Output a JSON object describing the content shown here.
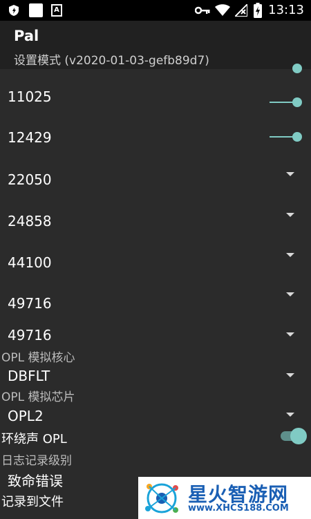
{
  "status_bar": {
    "time": "13:13",
    "left_icons": [
      "shield-icon",
      "square-icon",
      "a-badge-icon"
    ],
    "right_icons": [
      "key-icon",
      "wifi-icon",
      "no-signal-icon",
      "battery-charging-icon"
    ]
  },
  "app_bar": {
    "title": "Pal",
    "subtitle": "设置模式 (v2020-01-03-gefb89d7)"
  },
  "settings": {
    "rows": [
      {
        "label": "11025",
        "control": "slider",
        "value_fraction": 1.0
      },
      {
        "label": "12429",
        "control": "slider",
        "value_fraction": 1.0
      },
      {
        "label": "22050",
        "control": "dropdown"
      },
      {
        "label": "24858",
        "control": "dropdown"
      },
      {
        "label": "44100",
        "control": "dropdown"
      },
      {
        "label": "49716",
        "control": "dropdown"
      },
      {
        "label": "49716",
        "control": "dropdown"
      }
    ],
    "opl_core": {
      "label": "OPL 模拟核心",
      "value": "DBFLT"
    },
    "opl_chip": {
      "label": "OPL 模拟芯片",
      "value": "OPL2"
    },
    "surround_opl": {
      "label": "环绕声 OPL",
      "enabled": true
    },
    "log_level": {
      "label": "日志记录级别",
      "value": "致命错误"
    },
    "log_to_file": {
      "label": "记录到文件"
    }
  },
  "watermark": {
    "main": "星火智游网",
    "sub": "www.XHCS188.COM"
  },
  "colors": {
    "accent": "#80cbc4",
    "background": "#2b2b2b",
    "app_bar": "#212121",
    "status_bar": "#000000",
    "watermark_text": "#1a5fb4"
  }
}
